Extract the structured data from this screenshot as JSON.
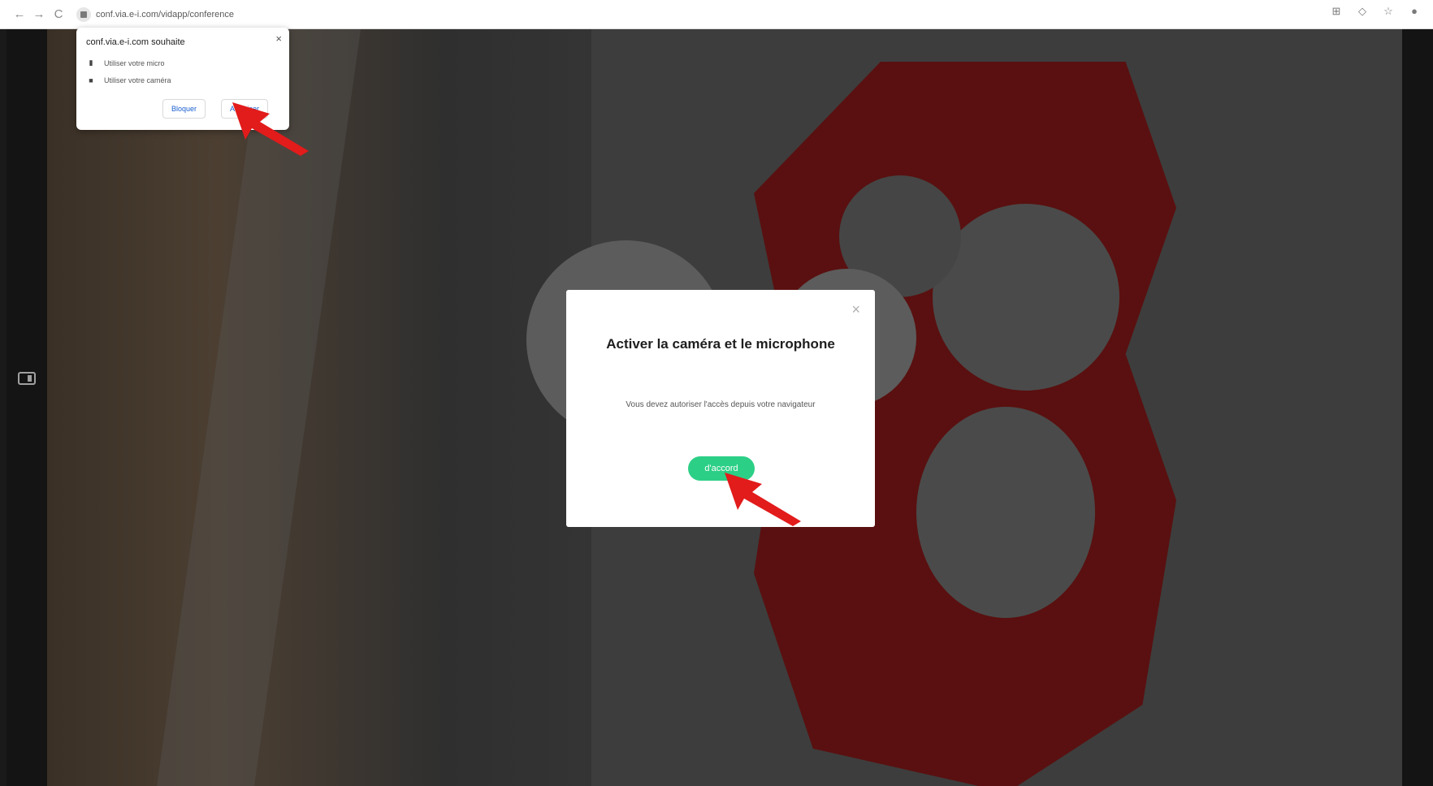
{
  "browser": {
    "url": "conf.via.e-i.com/vidapp/conference",
    "nav": {
      "back": "←",
      "forward": "→",
      "reload": "C"
    },
    "toolbar_icons": [
      "translate-icon",
      "extension-icon",
      "star-icon",
      "profile-icon"
    ]
  },
  "permission_popup": {
    "title": "conf.via.e-i.com souhaite",
    "close": "×",
    "items": [
      {
        "icon": "microphone-icon",
        "label": "Utiliser votre micro"
      },
      {
        "icon": "camera-icon",
        "label": "Utiliser votre caméra"
      }
    ],
    "block_label": "Bloquer",
    "allow_label": "Autoriser"
  },
  "modal": {
    "title": "Activer la caméra et le microphone",
    "subtitle": "Vous devez autoriser l'accès depuis votre navigateur",
    "button_label": "d'accord",
    "close": "×"
  },
  "colors": {
    "accent_green": "#2ccf86",
    "annotation_red": "#e21b1b",
    "link_blue": "#1a5fd0"
  }
}
